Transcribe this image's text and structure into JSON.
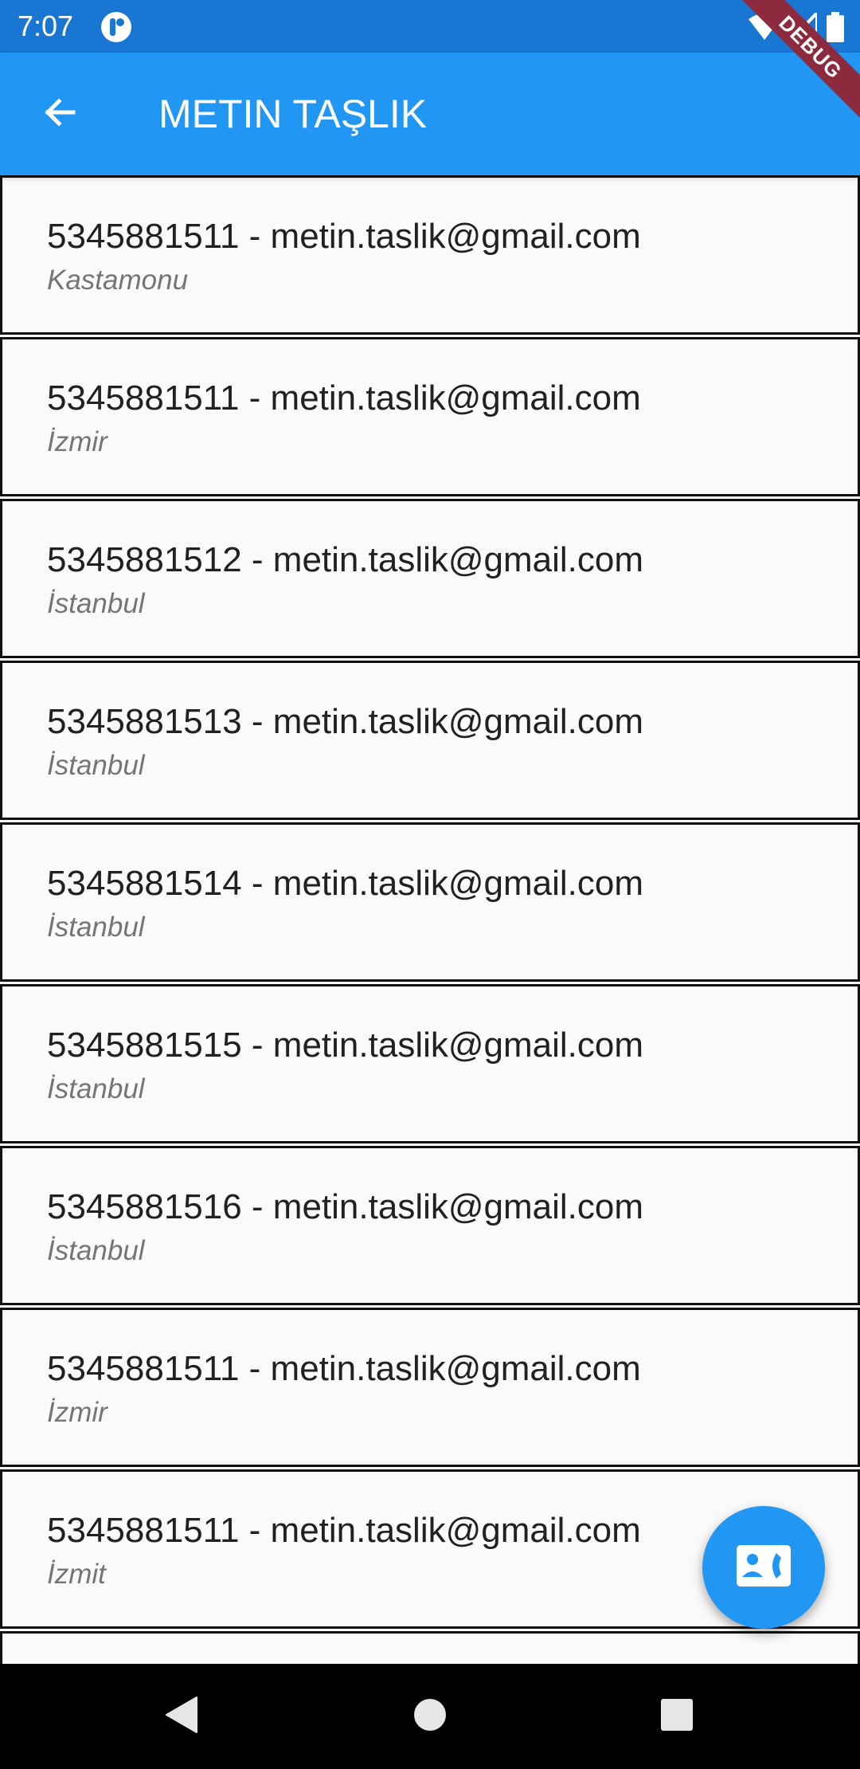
{
  "status_bar": {
    "time": "7:07",
    "icons": [
      "app-notification-icon",
      "wifi-icon",
      "signal-icon",
      "battery-icon"
    ]
  },
  "debug_banner": "DEBUG",
  "app_bar": {
    "title": "METIN TAŞLIK",
    "back_icon": "arrow-back-icon",
    "color": "#2196f3"
  },
  "contacts": [
    {
      "title": "5345881511 - metin.taslik@gmail.com",
      "subtitle": "Kastamonu"
    },
    {
      "title": "5345881511 - metin.taslik@gmail.com",
      "subtitle": "İzmir"
    },
    {
      "title": "5345881512 - metin.taslik@gmail.com",
      "subtitle": "İstanbul"
    },
    {
      "title": "5345881513 - metin.taslik@gmail.com",
      "subtitle": "İstanbul"
    },
    {
      "title": "5345881514 - metin.taslik@gmail.com",
      "subtitle": "İstanbul"
    },
    {
      "title": "5345881515 - metin.taslik@gmail.com",
      "subtitle": "İstanbul"
    },
    {
      "title": "5345881516 - metin.taslik@gmail.com",
      "subtitle": "İstanbul"
    },
    {
      "title": "5345881511 - metin.taslik@gmail.com",
      "subtitle": "İzmir"
    },
    {
      "title": "5345881511 - metin.taslik@gmail.com",
      "subtitle": "İzmit"
    },
    {
      "title": "",
      "subtitle": ""
    }
  ],
  "fab": {
    "icon": "contact-phone-icon",
    "color": "#2196f3"
  },
  "nav_bar": {
    "icons": [
      "back-triangle-icon",
      "home-circle-icon",
      "recents-square-icon"
    ]
  }
}
